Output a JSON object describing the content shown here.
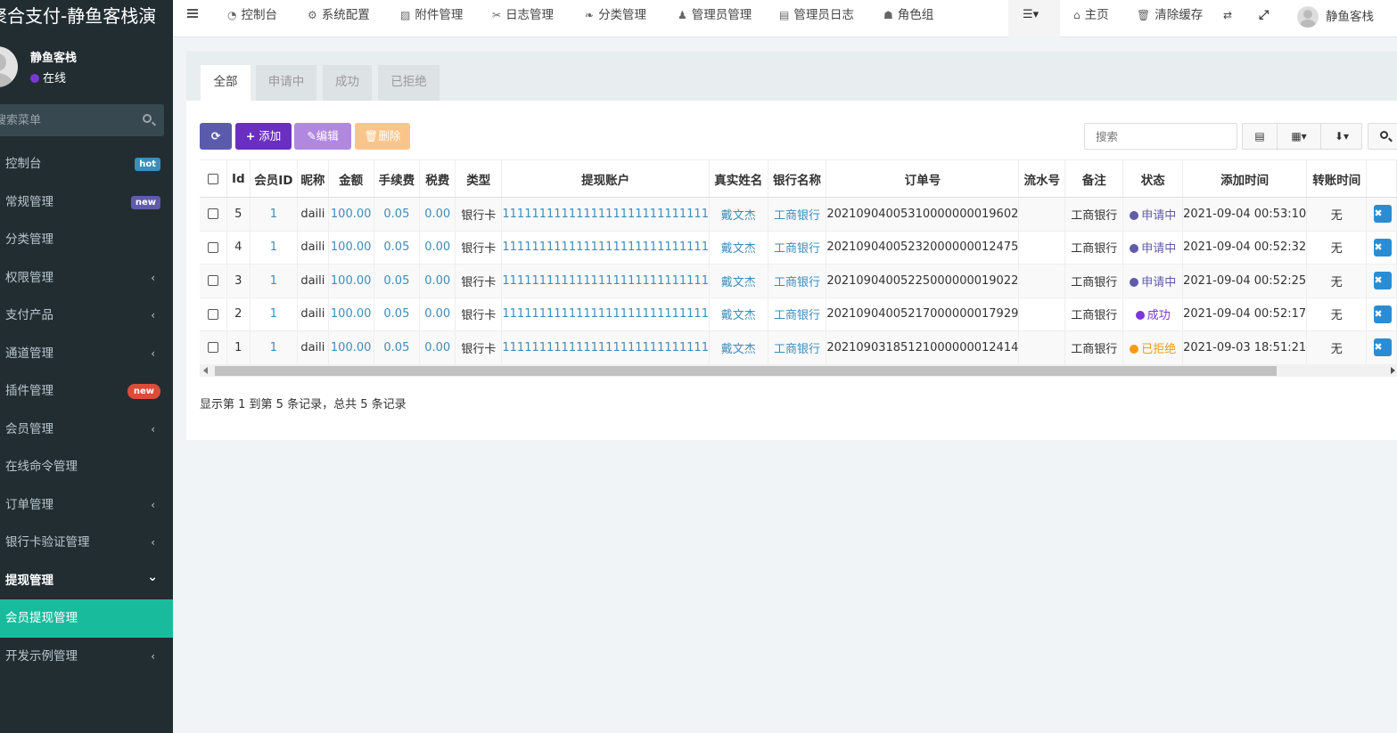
{
  "app": {
    "title": "聚合支付-静鱼客栈演"
  },
  "user": {
    "name": "静鱼客栈",
    "status": "在线"
  },
  "sidebar": {
    "search_placeholder": "搜索菜单",
    "items": [
      {
        "label": "控制台",
        "badge": "hot"
      },
      {
        "label": "常规管理",
        "badge": "new"
      },
      {
        "label": "分类管理"
      },
      {
        "label": "权限管理",
        "chevron": "‹"
      },
      {
        "label": "支付产品",
        "chevron": "‹"
      },
      {
        "label": "通道管理",
        "chevron": "‹"
      },
      {
        "label": "插件管理",
        "badge": "new"
      },
      {
        "label": "会员管理",
        "chevron": "‹"
      },
      {
        "label": "在线命令管理"
      },
      {
        "label": "订单管理",
        "chevron": "‹"
      },
      {
        "label": "银行卡验证管理",
        "chevron": "‹"
      },
      {
        "label": "提现管理",
        "chevron": "⌄"
      },
      {
        "label": "会员提现管理"
      },
      {
        "label": "开发示例管理",
        "chevron": "‹"
      }
    ]
  },
  "topnav": {
    "items": [
      {
        "label": "控制台",
        "icon": "dashboard-icon"
      },
      {
        "label": "系统配置",
        "icon": "gear-icon"
      },
      {
        "label": "附件管理",
        "icon": "file-image-icon"
      },
      {
        "label": "日志管理",
        "icon": "tools-icon"
      },
      {
        "label": "分类管理",
        "icon": "leaf-icon"
      },
      {
        "label": "管理员管理",
        "icon": "user-icon"
      },
      {
        "label": "管理员日志",
        "icon": "list-alt-icon"
      },
      {
        "label": "角色组",
        "icon": "group-icon"
      }
    ],
    "right": {
      "home": "主页",
      "clear_cache": "清除缓存",
      "username": "静鱼客栈"
    }
  },
  "tabs": [
    "全部",
    "申请中",
    "成功",
    "已拒绝"
  ],
  "toolbar": {
    "add": "添加",
    "edit": "编辑",
    "delete": "删除",
    "search_placeholder": "搜索"
  },
  "table": {
    "columns": [
      "Id",
      "会员ID",
      "昵称",
      "金额",
      "手续费",
      "税费",
      "类型",
      "提现账户",
      "真实姓名",
      "银行名称",
      "订单号",
      "流水号",
      "备注",
      "状态",
      "添加时间",
      "转账时间"
    ],
    "rows": [
      {
        "id": "5",
        "member_id": "1",
        "nickname": "daili",
        "amount": "100.00",
        "fee": "0.05",
        "tax": "0.00",
        "type": "银行卡",
        "account": "1111111111111111111111111111",
        "realname": "戴文杰",
        "bank": "工商银行",
        "order_no": "20210904005310000000019602",
        "serial": "",
        "remark": "工商银行",
        "status": "申请中",
        "status_color": "#605ca8",
        "added": "2021-09-04 00:53:10",
        "transfer": "无"
      },
      {
        "id": "4",
        "member_id": "1",
        "nickname": "daili",
        "amount": "100.00",
        "fee": "0.05",
        "tax": "0.00",
        "type": "银行卡",
        "account": "1111111111111111111111111111",
        "realname": "戴文杰",
        "bank": "工商银行",
        "order_no": "20210904005232000000012475",
        "serial": "",
        "remark": "工商银行",
        "status": "申请中",
        "status_color": "#605ca8",
        "added": "2021-09-04 00:52:32",
        "transfer": "无"
      },
      {
        "id": "3",
        "member_id": "1",
        "nickname": "daili",
        "amount": "100.00",
        "fee": "0.05",
        "tax": "0.00",
        "type": "银行卡",
        "account": "1111111111111111111111111111",
        "realname": "戴文杰",
        "bank": "工商银行",
        "order_no": "20210904005225000000019022",
        "serial": "",
        "remark": "工商银行",
        "status": "申请中",
        "status_color": "#605ca8",
        "added": "2021-09-04 00:52:25",
        "transfer": "无"
      },
      {
        "id": "2",
        "member_id": "1",
        "nickname": "daili",
        "amount": "100.00",
        "fee": "0.05",
        "tax": "0.00",
        "type": "银行卡",
        "account": "1111111111111111111111111111",
        "realname": "戴文杰",
        "bank": "工商银行",
        "order_no": "20210904005217000000017929",
        "serial": "",
        "remark": "工商银行",
        "status": "成功",
        "status_color": "#7a38d6",
        "added": "2021-09-04 00:52:17",
        "transfer": "无"
      },
      {
        "id": "1",
        "member_id": "1",
        "nickname": "daili",
        "amount": "100.00",
        "fee": "0.05",
        "tax": "0.00",
        "type": "银行卡",
        "account": "1111111111111111111111111111",
        "realname": "戴文杰",
        "bank": "工商银行",
        "order_no": "20210903185121000000012414",
        "serial": "",
        "remark": "工商银行",
        "status": "已拒绝",
        "status_color": "#f39c12",
        "added": "2021-09-03 18:51:21",
        "transfer": "无"
      }
    ]
  },
  "pagination": {
    "summary": "显示第 1 到第 5 条记录，总共 5 条记录"
  }
}
